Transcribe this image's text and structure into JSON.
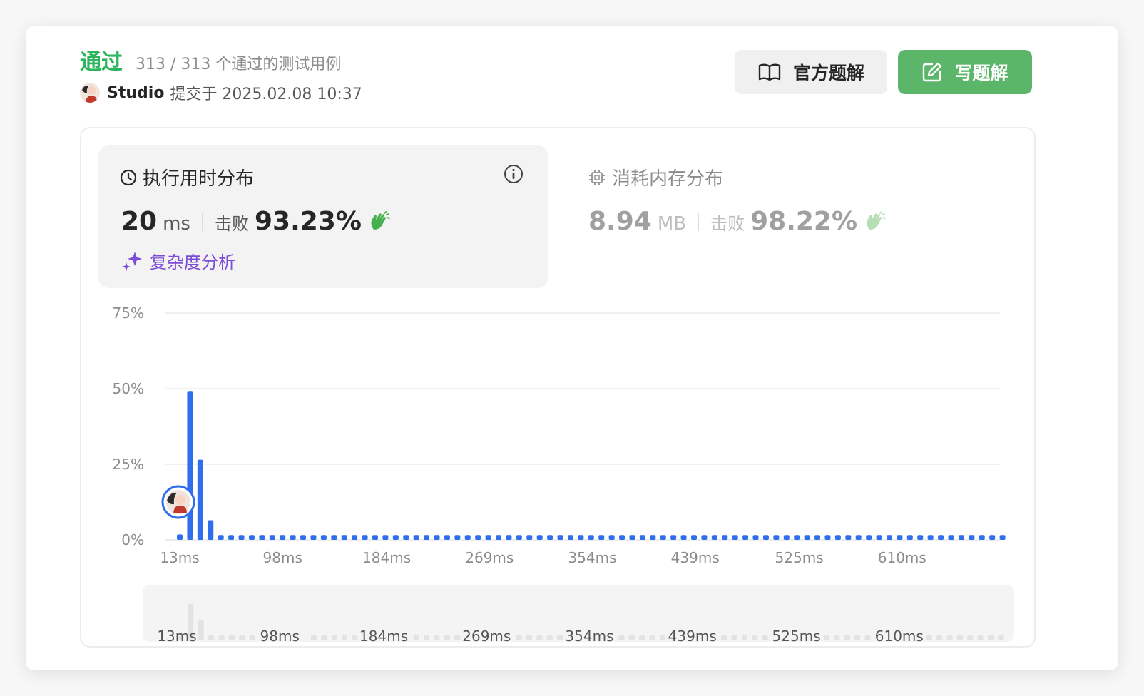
{
  "header": {
    "status_label": "通过",
    "test_count": "313 / 313 个通过的测试用例",
    "submitter_name": "Studio",
    "submitted_at": "提交于 2025.02.08 10:37"
  },
  "buttons": {
    "official_solution": "官方题解",
    "write_solution": "写题解"
  },
  "runtime": {
    "title": "执行用时分布",
    "value": "20",
    "unit": "ms",
    "beat_label": "击败",
    "beat_pct": "93.23%",
    "complexity_link": "复杂度分析"
  },
  "memory": {
    "title": "消耗内存分布",
    "value": "8.94",
    "unit": "MB",
    "beat_label": "击败",
    "beat_pct": "98.22%"
  },
  "colors": {
    "accent_green": "#2db55d",
    "button_green": "#5cb66a",
    "bar_blue": "#2f6fed",
    "purple": "#7c4dd8"
  },
  "icons": {
    "official_solution": "book-icon",
    "write_solution": "edit-icon",
    "runtime": "clock-icon",
    "memory": "chip-icon",
    "info": "info-icon",
    "beat": "clap-icon",
    "complexity": "sparkle-icon"
  },
  "chart_data": {
    "type": "bar",
    "title": "",
    "xlabel": "",
    "ylabel": "",
    "y_tick_labels": [
      "0%",
      "25%",
      "50%",
      "75%"
    ],
    "x_tick_labels": [
      "13ms",
      "98ms",
      "184ms",
      "269ms",
      "354ms",
      "439ms",
      "525ms",
      "610ms"
    ],
    "x_tick_values": [
      13,
      98,
      184,
      269,
      354,
      439,
      525,
      610
    ],
    "ylim": [
      0,
      75
    ],
    "x_start": 13,
    "x_step": 8.5,
    "values": [
      1.8,
      49,
      26.5,
      6.5,
      1.6,
      1.6,
      1.6,
      1.6,
      1.6,
      1.6,
      1.6,
      1.6,
      1.6,
      1.6,
      1.6,
      1.6,
      1.6,
      1.6,
      1.6,
      1.6,
      1.6,
      1.6,
      1.6,
      1.6,
      1.6,
      1.6,
      1.6,
      1.6,
      1.6,
      1.6,
      1.6,
      1.6,
      1.6,
      1.6,
      1.6,
      1.6,
      1.6,
      1.6,
      1.6,
      1.6,
      1.6,
      1.6,
      1.6,
      1.6,
      1.6,
      1.6,
      1.6,
      1.6,
      1.6,
      1.6,
      1.6,
      1.6,
      1.6,
      1.6,
      1.6,
      1.6,
      1.6,
      1.6,
      1.6,
      1.6,
      1.6,
      1.6,
      1.6,
      1.6,
      1.6,
      1.6,
      1.6,
      1.6,
      1.6,
      1.6,
      1.6,
      1.6,
      1.6,
      1.6,
      1.6,
      1.6,
      1.6,
      1.6,
      1.6,
      1.6,
      1.6
    ],
    "current_value_ms": 13,
    "current_pct": 12.5,
    "grid": true,
    "bar_color": "#2f6fed"
  }
}
